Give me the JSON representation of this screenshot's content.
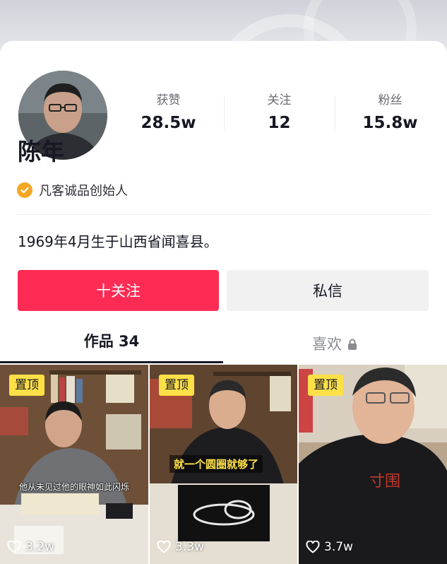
{
  "profile": {
    "name": "陈年",
    "verify_text": "凡客诚品创始人",
    "bio": "1969年4月生于山西省闻喜县。"
  },
  "stats": [
    {
      "label": "获赞",
      "value": "28.5w"
    },
    {
      "label": "关注",
      "value": "12"
    },
    {
      "label": "粉丝",
      "value": "15.8w"
    }
  ],
  "buttons": {
    "follow": "十关注",
    "message": "私信"
  },
  "tabs": {
    "works": "作品 34",
    "likes": "喜欢"
  },
  "videos": [
    {
      "pinned": "置顶",
      "caption": "他从未见过他的眼神如此闪烁",
      "likes": "3.2w"
    },
    {
      "pinned": "置顶",
      "caption": "就一个圆圈就够了",
      "likes": "3.3w"
    },
    {
      "pinned": "置顶",
      "caption": "",
      "likes": "3.7w"
    }
  ],
  "colors": {
    "accent": "#fe2c55",
    "verify": "#f5a623",
    "pin": "#fde047"
  },
  "icons": [
    "verified-check-icon",
    "lock-icon",
    "heart-icon"
  ]
}
